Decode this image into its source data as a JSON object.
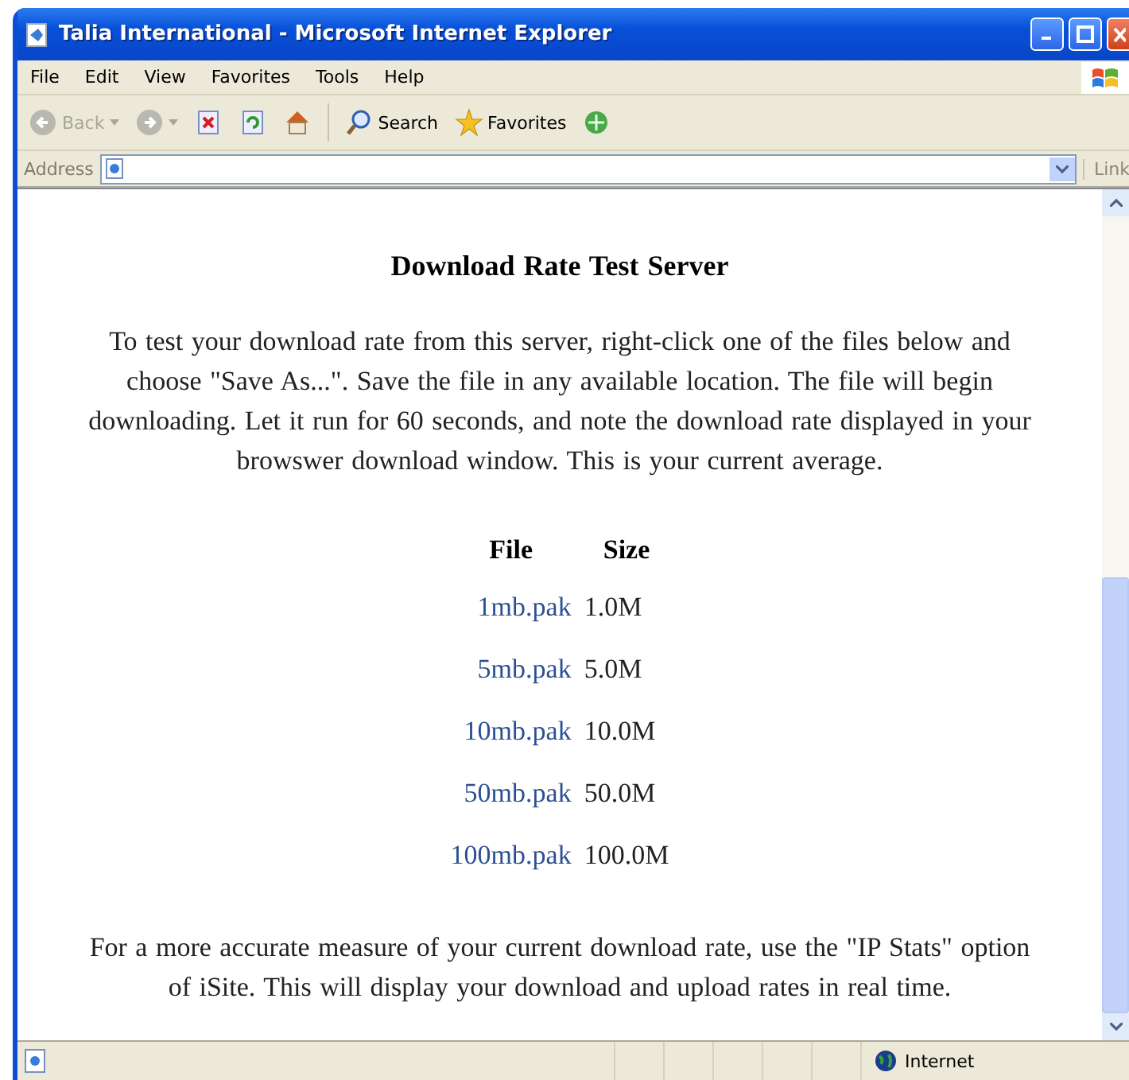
{
  "window": {
    "title": "Talia International - Microsoft Internet Explorer"
  },
  "menu": [
    "File",
    "Edit",
    "View",
    "Favorites",
    "Tools",
    "Help"
  ],
  "toolbar": [
    {
      "kind": "back",
      "label": "Back",
      "disabled": true
    },
    {
      "kind": "forward",
      "disabled": true
    },
    {
      "kind": "stop"
    },
    {
      "kind": "refresh"
    },
    {
      "kind": "home"
    },
    {
      "kind": "search",
      "label": "Search"
    },
    {
      "kind": "favorites",
      "label": "Favorites"
    },
    {
      "kind": "media"
    }
  ],
  "address_bar": {
    "label": "Address",
    "links_label": "Link"
  },
  "page": {
    "heading": "Download Rate Test Server",
    "intro": "To test your download rate from this server, right-click one of the files below and choose \"Save As...\". Save the file in any available location. The file will begin downloading. Let it run for 60 seconds, and note the download rate displayed in your browswer download window. This is your current average.",
    "table": {
      "columns": [
        "File",
        "Size"
      ],
      "rows": [
        {
          "file": "1mb.pak",
          "size": "1.0M"
        },
        {
          "file": "5mb.pak",
          "size": "5.0M"
        },
        {
          "file": "10mb.pak",
          "size": "10.0M"
        },
        {
          "file": "50mb.pak",
          "size": "50.0M"
        },
        {
          "file": "100mb.pak",
          "size": "100.0M"
        }
      ]
    },
    "note": "For a more accurate measure of your current download rate, use the \"IP Stats\" option of iSite. This will display your download and upload rates in real time."
  },
  "status_bar": {
    "zone": "Internet"
  }
}
